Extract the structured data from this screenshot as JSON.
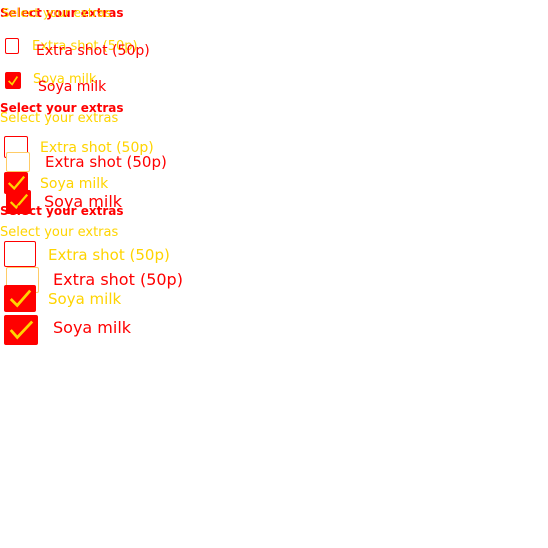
{
  "heading": "Select your extras",
  "options": [
    {
      "label": "Extra shot (50p)",
      "checked": false
    },
    {
      "label": "Soya milk",
      "checked": true
    }
  ],
  "colors": {
    "primary": "#ff0000",
    "secondary": "#ffd400",
    "background": "#ffffff"
  },
  "icons": {
    "checked": "checkmark-icon"
  }
}
